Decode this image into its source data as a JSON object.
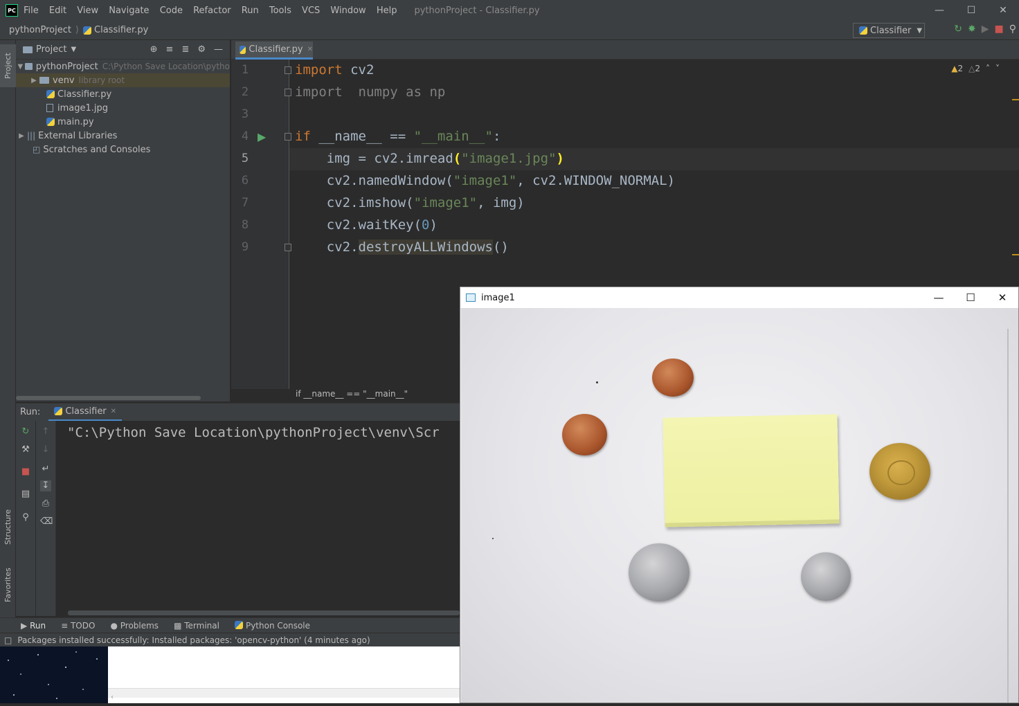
{
  "titlebar": {
    "logo": "PC",
    "menu": [
      "File",
      "Edit",
      "View",
      "Navigate",
      "Code",
      "Refactor",
      "Run",
      "Tools",
      "VCS",
      "Window",
      "Help"
    ],
    "window_title": "pythonProject - Classifier.py",
    "controls": [
      "minimize-icon",
      "maximize-icon",
      "close-icon"
    ]
  },
  "navbar": {
    "project": "pythonProject",
    "file": "Classifier.py",
    "run_config": "Classifier",
    "tools": [
      "rerun-icon",
      "debug-icon",
      "coverage-icon",
      "stop-icon",
      "search-icon"
    ]
  },
  "left_strip": {
    "tabs": [
      "Project",
      "Structure",
      "Favorites"
    ]
  },
  "project_panel": {
    "header": "Project",
    "tree": [
      {
        "label": "pythonProject",
        "hint": "C:\\Python Save Location\\pytho",
        "type": "folder",
        "level": 0
      },
      {
        "label": "venv",
        "hint": "library root",
        "type": "folder",
        "level": 1
      },
      {
        "label": "Classifier.py",
        "hint": "",
        "type": "python",
        "level": 1
      },
      {
        "label": "image1.jpg",
        "hint": "",
        "type": "image",
        "level": 1
      },
      {
        "label": "main.py",
        "hint": "",
        "type": "python",
        "level": 1
      },
      {
        "label": "External Libraries",
        "hint": "",
        "type": "library",
        "level": 0
      },
      {
        "label": "Scratches and Consoles",
        "hint": "",
        "type": "scratch",
        "level": 0
      }
    ]
  },
  "editor": {
    "tab": "Classifier.py",
    "line_numbers": [
      "1",
      "2",
      "3",
      "4",
      "5",
      "6",
      "7",
      "8",
      "9"
    ],
    "breadcrumb": "if __name__ == \"__main__\"",
    "warnings": [
      "2",
      "2"
    ],
    "code": {
      "l1_kw": "import",
      "l1_rest": " cv2",
      "l2": "import  numpy as np",
      "l4_kw": "if",
      "l4_mid": " __name__ == ",
      "l4_str": "\"__main__\"",
      "l4_end": ":",
      "l5_a": "    img = cv2.imread",
      "l5_p1": "(",
      "l5_str": "\"image1.jpg\"",
      "l5_p2": ")",
      "l6_a": "    cv2.namedWindow(",
      "l6_str": "\"image1\"",
      "l6_b": ", cv2.WINDOW_NORMAL)",
      "l7_a": "    cv2.imshow(",
      "l7_str": "\"image1\"",
      "l7_b": ", img)",
      "l8_a": "    cv2.waitKey(",
      "l8_num": "0",
      "l8_b": ")",
      "l9_a": "    cv2.",
      "l9_fn": "destroyALLWindows",
      "l9_b": "()"
    }
  },
  "run_panel": {
    "label": "Run:",
    "tab": "Classifier",
    "output": "\"C:\\Python Save Location\\pythonProject\\venv\\Scr"
  },
  "bottom_tabs": [
    "Run",
    "TODO",
    "Problems",
    "Terminal",
    "Python Console"
  ],
  "status": "Packages installed successfully: Installed packages: 'opencv-python' (4 minutes ago)",
  "image_window": {
    "title": "image1",
    "controls": [
      "minimize-icon",
      "maximize-icon",
      "close-icon"
    ]
  }
}
